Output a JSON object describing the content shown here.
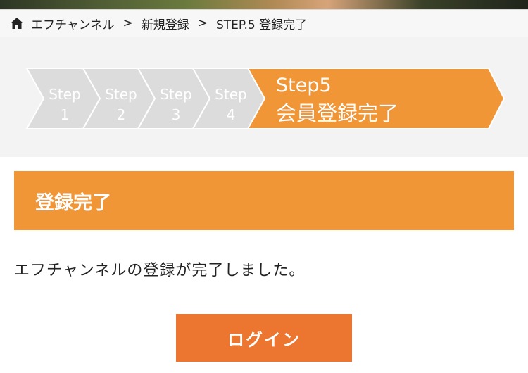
{
  "breadcrumb": {
    "items": [
      "エフチャンネル",
      "新規登録",
      "STEP.5 登録完了"
    ],
    "separator": ">"
  },
  "steps": [
    {
      "word": "Step",
      "num": "1",
      "state": "done"
    },
    {
      "word": "Step",
      "num": "2",
      "state": "done"
    },
    {
      "word": "Step",
      "num": "3",
      "state": "done"
    },
    {
      "word": "Step",
      "num": "4",
      "state": "done"
    },
    {
      "word": "Step5",
      "num": "会員登録完了",
      "state": "current"
    }
  ],
  "panel": {
    "heading": "登録完了"
  },
  "message": "エフチャンネルの登録が完了しました。",
  "login_button": {
    "label": "ログイン"
  },
  "colors": {
    "accent": "#f19637",
    "button": "#ec7530",
    "step_inactive": "#dcdcdc",
    "step_text": "#ffffff"
  },
  "icons": {
    "home": "home-icon"
  }
}
